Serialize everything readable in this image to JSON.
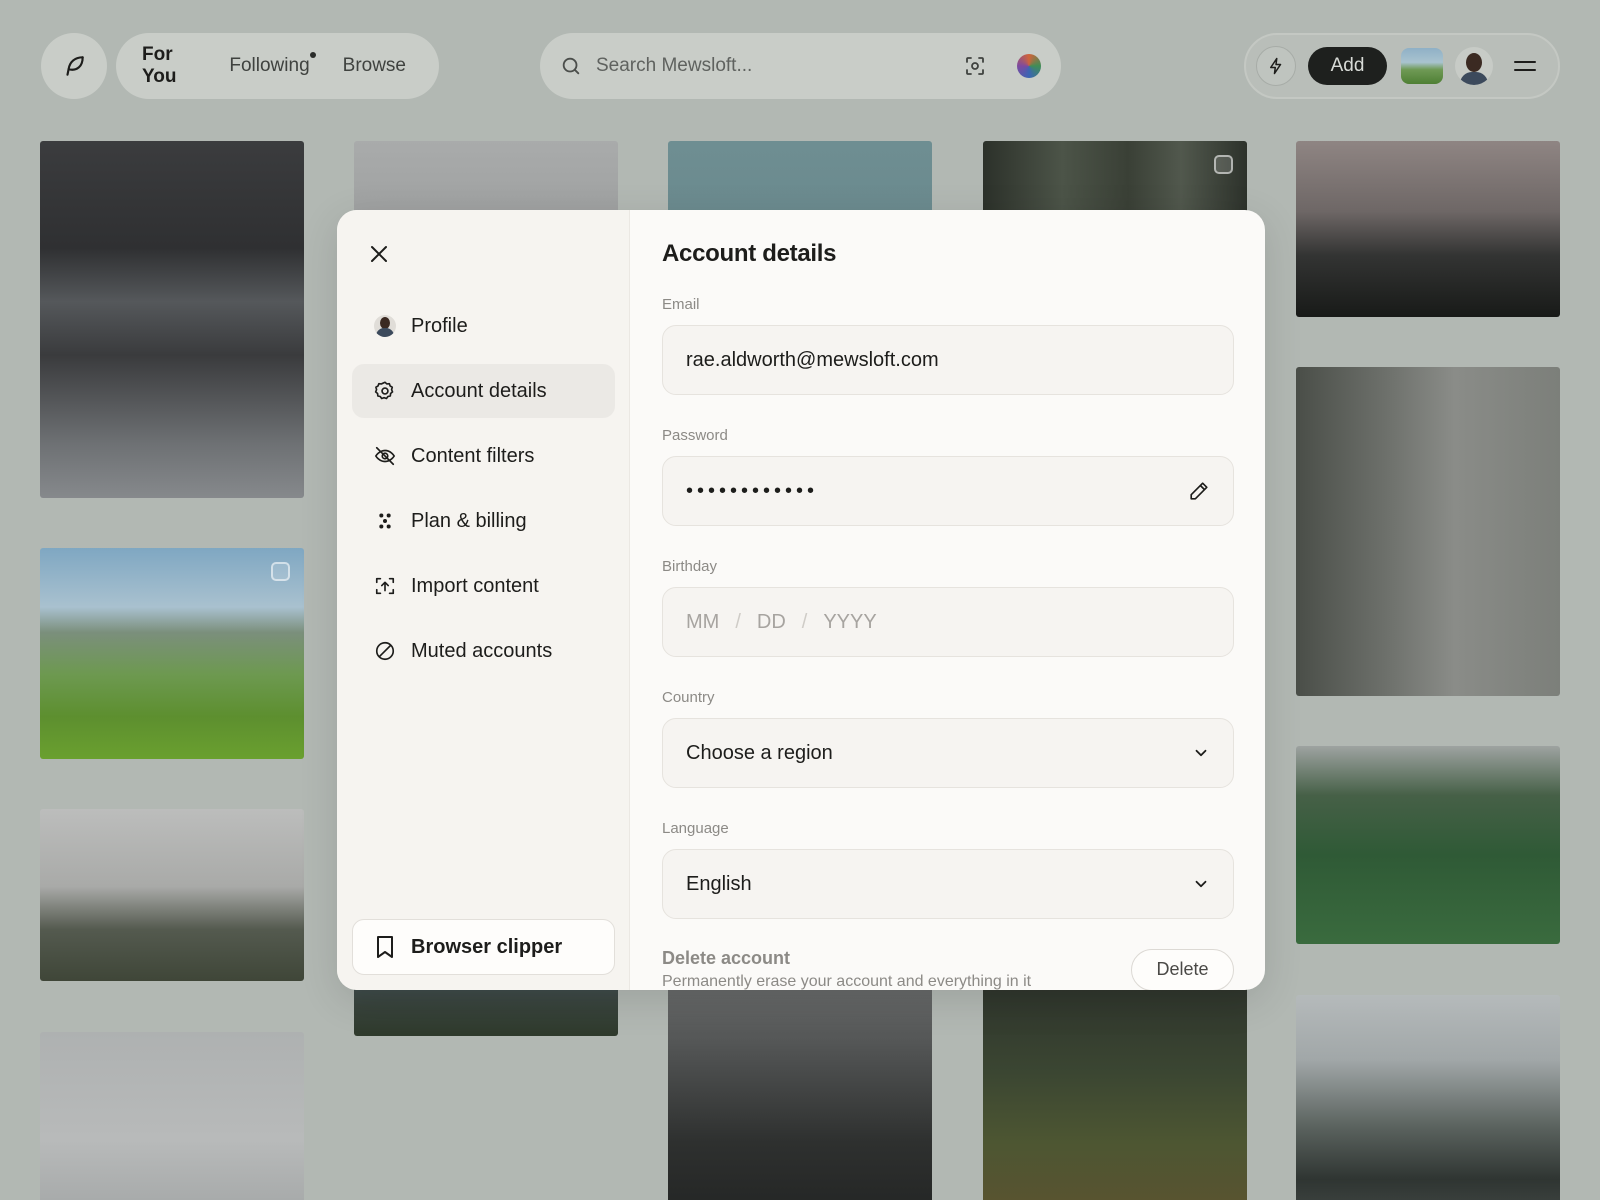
{
  "topbar": {
    "logo_icon": "feather-icon",
    "tabs": [
      {
        "label": "For You",
        "active": true
      },
      {
        "label": "Following",
        "has_dot": true
      },
      {
        "label": "Browse"
      }
    ],
    "search": {
      "placeholder": "Search Mewsloft...",
      "value": ""
    },
    "add_label": "Add"
  },
  "modal": {
    "nav": [
      {
        "label": "Profile",
        "icon": "avatar-icon"
      },
      {
        "label": "Account details",
        "icon": "gear-icon",
        "active": true
      },
      {
        "label": "Content filters",
        "icon": "eye-off-icon"
      },
      {
        "label": "Plan & billing",
        "icon": "dots-icon"
      },
      {
        "label": "Import content",
        "icon": "import-icon"
      },
      {
        "label": "Muted accounts",
        "icon": "blocked-icon"
      }
    ],
    "clipper_label": "Browser clipper",
    "title": "Account details",
    "email": {
      "label": "Email",
      "value": "rae.aldworth@mewsloft.com"
    },
    "password": {
      "label": "Password",
      "value": "••••••••••••"
    },
    "birthday": {
      "label": "Birthday",
      "mm": "MM",
      "sep": "/",
      "dd": "DD",
      "yyyy": "YYYY"
    },
    "country": {
      "label": "Country",
      "value": "Choose a region"
    },
    "language": {
      "label": "Language",
      "value": "English"
    },
    "delete": {
      "title": "Delete account",
      "description": "Permanently erase your account and everything in it",
      "button": "Delete"
    }
  },
  "colors": {
    "background": "#b2b8b3",
    "modal_bg": "#fbfaf8",
    "sidebar_bg": "#f6f4f0",
    "primary_button": "#1e201e"
  }
}
